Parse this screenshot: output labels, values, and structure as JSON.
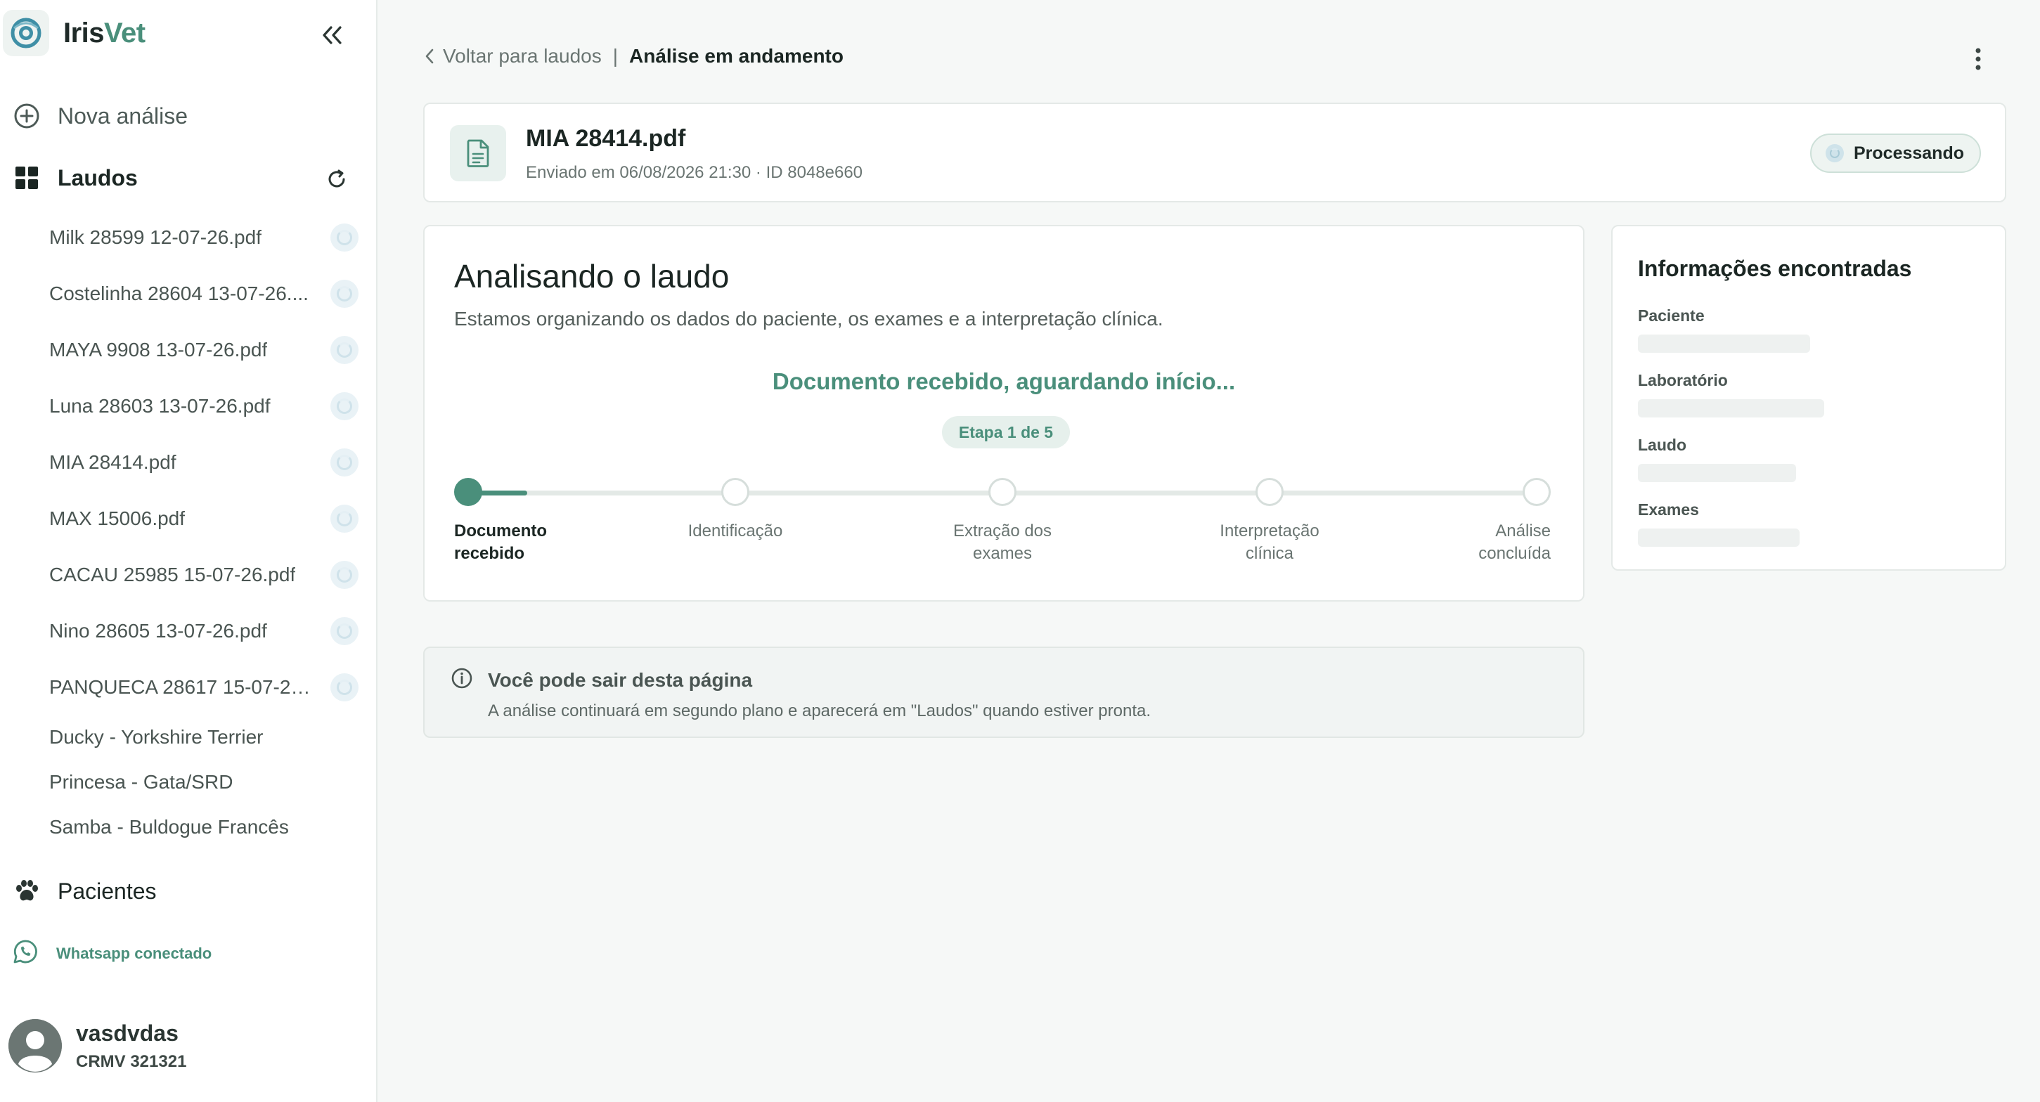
{
  "brand": {
    "name_part1": "Iris",
    "name_part2": "Vet"
  },
  "sidebar": {
    "new_analysis_label": "Nova análise",
    "laudos_label": "Laudos",
    "reports": [
      {
        "name": "Milk 28599 12-07-26.pdf"
      },
      {
        "name": "Costelinha 28604 13-07-26...."
      },
      {
        "name": "MAYA 9908 13-07-26.pdf"
      },
      {
        "name": "Luna 28603 13-07-26.pdf"
      },
      {
        "name": "MIA 28414.pdf"
      },
      {
        "name": "MAX 15006.pdf"
      },
      {
        "name": "CACAU 25985 15-07-26.pdf"
      },
      {
        "name": "Nino 28605 13-07-26.pdf"
      },
      {
        "name": "PANQUECA 28617 15-07-26..."
      }
    ],
    "patients": [
      {
        "name": "Ducky - Yorkshire Terrier"
      },
      {
        "name": "Princesa - Gata/SRD"
      },
      {
        "name": "Samba - Buldogue Francês"
      }
    ],
    "pacientes_label": "Pacientes",
    "whatsapp_label": "Whatsapp conectado"
  },
  "user": {
    "name": "vasdvdas",
    "crmv": "CRMV 321321"
  },
  "breadcrumb": {
    "back_label": "Voltar para laudos",
    "separator": "|",
    "current": "Análise em andamento"
  },
  "file": {
    "name": "MIA 28414.pdf",
    "meta": "Enviado em 06/08/2026 21:30 · ID 8048e660",
    "status_label": "Processando"
  },
  "analysis": {
    "title": "Analisando o laudo",
    "subtitle": "Estamos organizando os dados do paciente, os exames e a interpretação clínica.",
    "status_message": "Documento recebido, aguardando início...",
    "step_indicator": "Etapa 1 de 5",
    "progress_fraction": 0.055,
    "current_step_index": 0,
    "steps": [
      {
        "label": "Documento\nrecebido"
      },
      {
        "label": "Identificação"
      },
      {
        "label": "Extração dos\nexames"
      },
      {
        "label": "Interpretação\nclínica"
      },
      {
        "label": "Análise\nconcluída"
      }
    ]
  },
  "info_panel": {
    "title": "Informações encontradas",
    "fields": [
      {
        "label": "Paciente",
        "fill": 0.5
      },
      {
        "label": "Laboratório",
        "fill": 0.54
      },
      {
        "label": "Laudo",
        "fill": 0.46
      },
      {
        "label": "Exames",
        "fill": 0.47
      }
    ]
  },
  "notice": {
    "title": "Você pode sair desta página",
    "text": "A análise continuará em segundo plano e aparecerá em \"Laudos\" quando estiver pronta."
  },
  "colors": {
    "accent": "#4a8f7b",
    "background": "#f6f8f7",
    "text_primary": "#1b2623",
    "text_muted": "#6a7572"
  },
  "icons": {
    "logo": "eye-logo-icon",
    "collapse": "double-chevron-left-icon",
    "new_analysis": "plus-circle-icon",
    "laudos": "grid-icon",
    "refresh": "refresh-icon",
    "report_status": "processing-spinner-icon",
    "pacientes": "paw-icon",
    "whatsapp": "whatsapp-icon",
    "avatar": "user-avatar-icon",
    "back": "chevron-left-icon",
    "more": "more-vertical-icon",
    "file": "document-icon",
    "info": "info-icon"
  }
}
